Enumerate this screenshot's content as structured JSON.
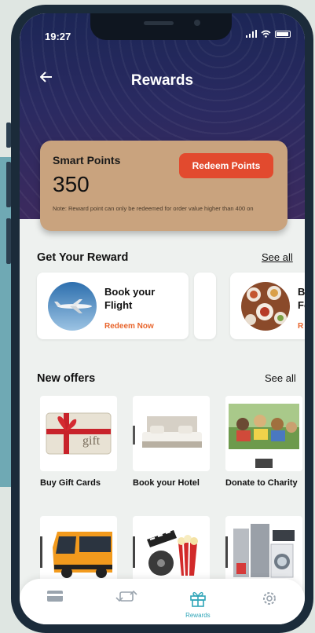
{
  "status": {
    "time": "19:27"
  },
  "header": {
    "title": "Rewards",
    "back_icon": "arrow-left-icon"
  },
  "points": {
    "label": "Smart Points",
    "value": "350",
    "redeem_label": "Redeem Points",
    "note": "Note: Reward point can only be redeemed for order value higher than 400 on"
  },
  "get_reward": {
    "title": "Get Your Reward",
    "see_all": "See all",
    "items": [
      {
        "name": "Book your Flight",
        "link": "Redeem Now"
      },
      {
        "name": "Bo Fo",
        "link": "R"
      }
    ]
  },
  "new_offers": {
    "title": "New offers",
    "see_all": "See all",
    "items": [
      {
        "label": "Buy Gift Cards",
        "image_text": "gift"
      },
      {
        "label": "Book your Hotel"
      },
      {
        "label": "Donate to Charity"
      },
      {
        "label": ""
      },
      {
        "label": ""
      },
      {
        "label": ""
      }
    ]
  },
  "tabbar": {
    "items": [
      {
        "icon": "card-icon",
        "label": ""
      },
      {
        "icon": "exchange-icon",
        "label": ""
      },
      {
        "icon": "gift-icon",
        "label": "Rewards",
        "active": true
      },
      {
        "icon": "gear-icon",
        "label": ""
      }
    ]
  },
  "colors": {
    "accent": "#e24a2e",
    "link_orange": "#e8642b",
    "active_tab": "#2fa5b8",
    "card_tan": "#c9a37e"
  }
}
